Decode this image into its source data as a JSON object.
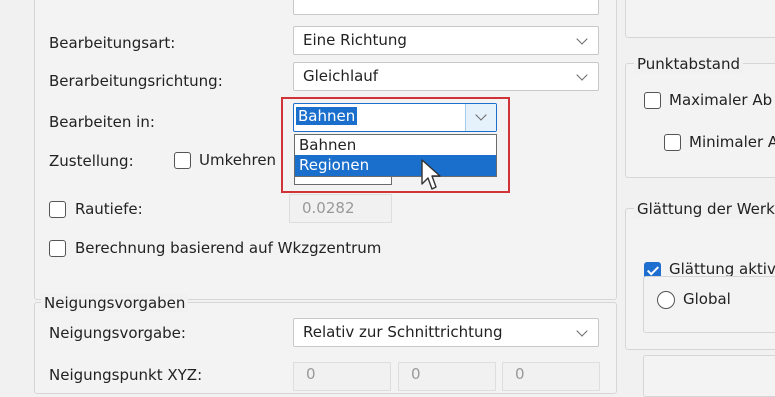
{
  "options": {
    "bearbeitungsart_label": "Bearbeitungsart:",
    "bearbeitungsart_value": "Eine Richtung",
    "richtung_label": "Berarbeitungsrichtung:",
    "richtung_value": "Gleichlauf",
    "bearbeiten_label": "Bearbeiten in:",
    "bearbeiten_value": "Bahnen",
    "zustellung_label": "Zustellung:",
    "umkehren_label": "Umkehren",
    "rautiefe_label": "Rautiefe:",
    "rautiefe_value": "0.0282",
    "berechnung_label": "Berechnung basierend auf Wkzgzentrum"
  },
  "dropdown": {
    "items": [
      "Bahnen",
      "Regionen"
    ],
    "selected_index": 1
  },
  "neigung": {
    "group_title": "Neigungsvorgaben",
    "vorgabe_label": "Neigungsvorgabe:",
    "vorgabe_value": "Relativ zur Schnittrichtung",
    "punkt_label": "Neigungspunkt XYZ:",
    "xyz": [
      "0",
      "0",
      "0"
    ]
  },
  "punktabstand": {
    "group_title": "Punktabstand",
    "max_label": "Maximaler Ab",
    "min_label": "Minimaler A"
  },
  "glaettung": {
    "group_title": "Glättung der Werk",
    "aktiv_label": "Glättung aktiv",
    "global_label": "Global"
  },
  "colors": {
    "accent": "#1a6fcd",
    "highlight_border": "#d13438"
  }
}
